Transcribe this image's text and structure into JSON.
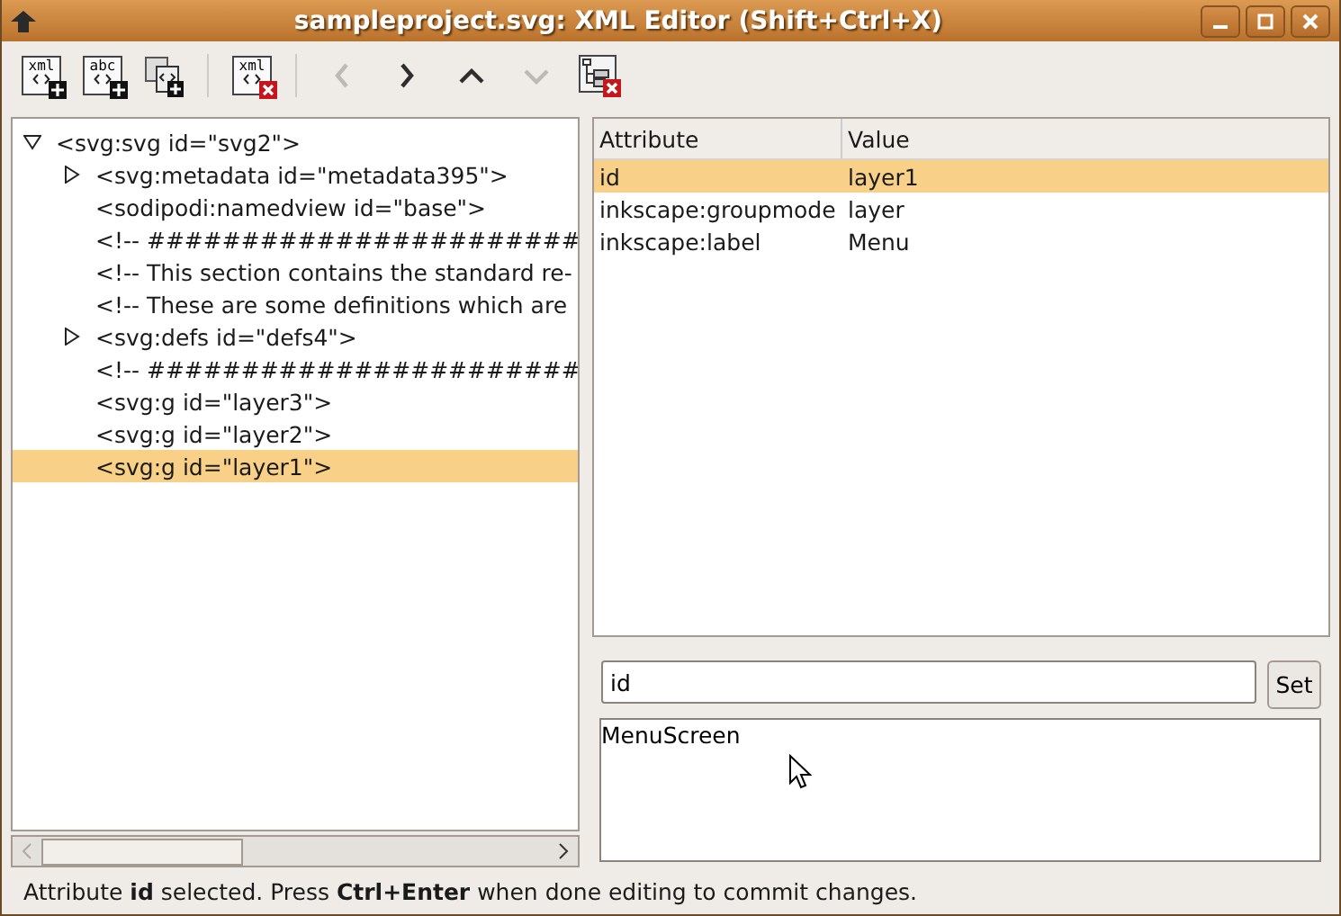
{
  "window": {
    "title": "sampleproject.svg: XML Editor (Shift+Ctrl+X)"
  },
  "toolbar": [
    {
      "kind": "newnode",
      "glyph": "xml",
      "disabled": false
    },
    {
      "kind": "newnode",
      "glyph": "abc",
      "disabled": false
    },
    {
      "kind": "duplicate",
      "disabled": false
    },
    {
      "kind": "separator"
    },
    {
      "kind": "deletenode",
      "glyph": "xml",
      "disabled": false
    },
    {
      "kind": "separator"
    },
    {
      "kind": "unindent",
      "disabled": true
    },
    {
      "kind": "indent",
      "disabled": false
    },
    {
      "kind": "raise",
      "disabled": false
    },
    {
      "kind": "lower",
      "disabled": true
    },
    {
      "kind": "deletetree",
      "disabled": false
    }
  ],
  "tree": [
    {
      "label": "<svg:svg id=\"svg2\">",
      "kind": "branch",
      "expanded": true,
      "selected": false,
      "children": [
        {
          "label": "<svg:metadata id=\"metadata395\">",
          "kind": "branch",
          "expanded": false,
          "selected": false
        },
        {
          "label": "<sodipodi:namedview id=\"base\">",
          "kind": "leaf",
          "selected": false
        },
        {
          "label": "<!-- #######################",
          "kind": "leaf",
          "selected": false
        },
        {
          "label": "<!-- This section contains the standard re-",
          "kind": "leaf",
          "selected": false
        },
        {
          "label": "<!-- These are some definitions which are",
          "kind": "leaf",
          "selected": false
        },
        {
          "label": "<svg:defs id=\"defs4\">",
          "kind": "branch",
          "expanded": false,
          "selected": false
        },
        {
          "label": "<!-- #######################",
          "kind": "leaf",
          "selected": false
        },
        {
          "label": "<svg:g id=\"layer3\">",
          "kind": "leaf",
          "selected": false
        },
        {
          "label": "<svg:g id=\"layer2\">",
          "kind": "leaf",
          "selected": false
        },
        {
          "label": "<svg:g id=\"layer1\">",
          "kind": "leaf",
          "selected": true
        }
      ]
    }
  ],
  "attributes": {
    "columns": [
      "Attribute",
      "Value"
    ],
    "rows": [
      {
        "name": "id",
        "value": "layer1",
        "selected": true
      },
      {
        "name": "inkscape:groupmode",
        "value": "layer",
        "selected": false
      },
      {
        "name": "inkscape:label",
        "value": "Menu",
        "selected": false
      }
    ]
  },
  "name_field": {
    "value": "id"
  },
  "set_button": "Set",
  "value_field": {
    "value": "MenuScreen"
  },
  "status_bar": "Attribute **id** selected. Press **Ctrl+Enter** when done editing to commit changes."
}
